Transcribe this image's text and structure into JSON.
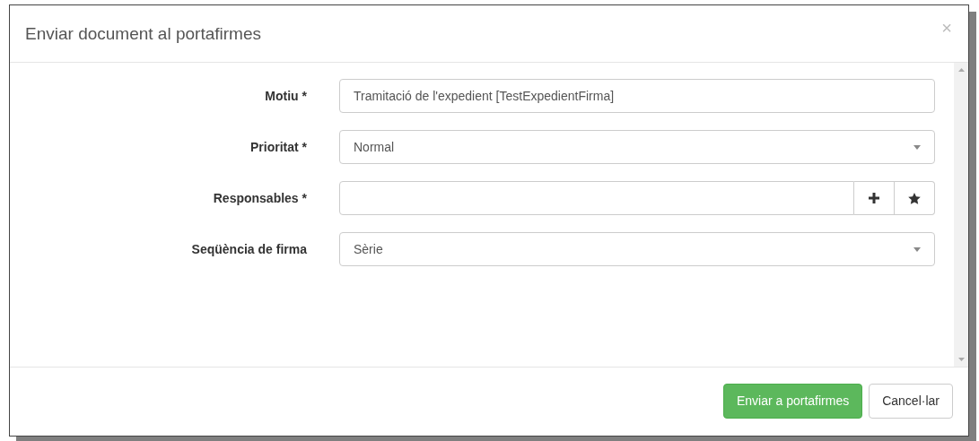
{
  "dialog": {
    "title": "Enviar document al portafirmes",
    "close": "×"
  },
  "fields": [
    {
      "kind": "text",
      "label": "Motiu *",
      "value": "Tramitació de l'expedient [TestExpedientFirma]"
    },
    {
      "kind": "select",
      "label": "Prioritat *",
      "value": "Normal"
    },
    {
      "kind": "picker",
      "label": "Responsables *"
    },
    {
      "kind": "select",
      "label": "Seqüència de firma",
      "value": "Sèrie"
    }
  ],
  "buttons": [
    {
      "label": "Enviar a portafirmes",
      "kind": "primary"
    },
    {
      "label": "Cancel·lar",
      "kind": "default"
    }
  ]
}
